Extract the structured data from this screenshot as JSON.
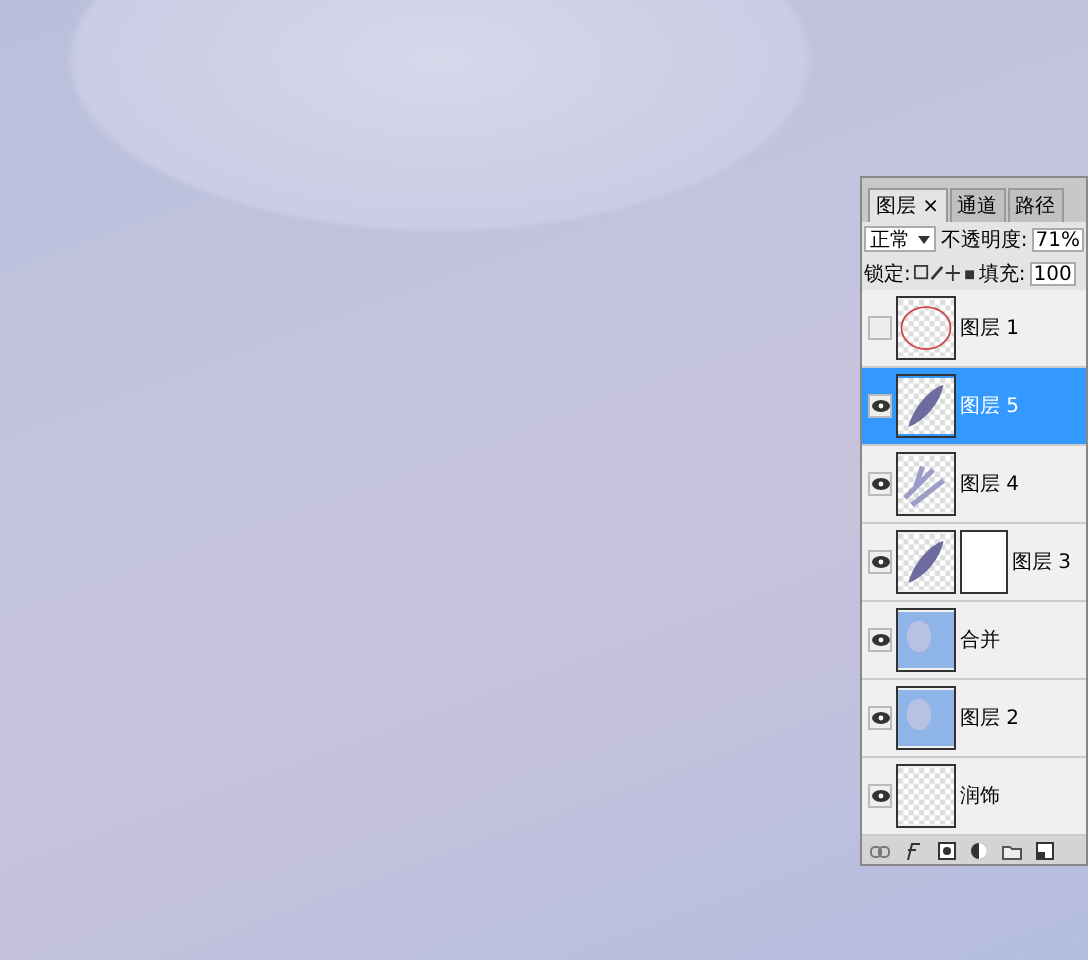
{
  "panel": {
    "tabs": [
      {
        "label": "图层",
        "close": "×",
        "selected": true
      },
      {
        "label": "通道",
        "selected": false
      },
      {
        "label": "路径",
        "selected": false
      }
    ],
    "blend_mode": "正常",
    "opacity_label": "不透明度:",
    "opacity": "71%",
    "lock_label": "锁定:",
    "fill_label": "填充:",
    "fill": "100",
    "layers": [
      {
        "name": "图层 1",
        "kind": "outline",
        "visible": false,
        "selected": false,
        "mask": false
      },
      {
        "name": "图层 5",
        "kind": "stroke",
        "visible": true,
        "selected": true,
        "mask": false
      },
      {
        "name": "图层 4",
        "kind": "streaks",
        "visible": true,
        "selected": false,
        "mask": false
      },
      {
        "name": "图层 3",
        "kind": "stroke",
        "visible": true,
        "selected": false,
        "mask": true
      },
      {
        "name": "合并",
        "kind": "photo",
        "visible": true,
        "selected": false,
        "mask": false
      },
      {
        "name": "图层 2",
        "kind": "photo",
        "visible": true,
        "selected": false,
        "mask": false
      },
      {
        "name": "润饰",
        "kind": "empty",
        "visible": true,
        "selected": false,
        "mask": false
      }
    ]
  }
}
